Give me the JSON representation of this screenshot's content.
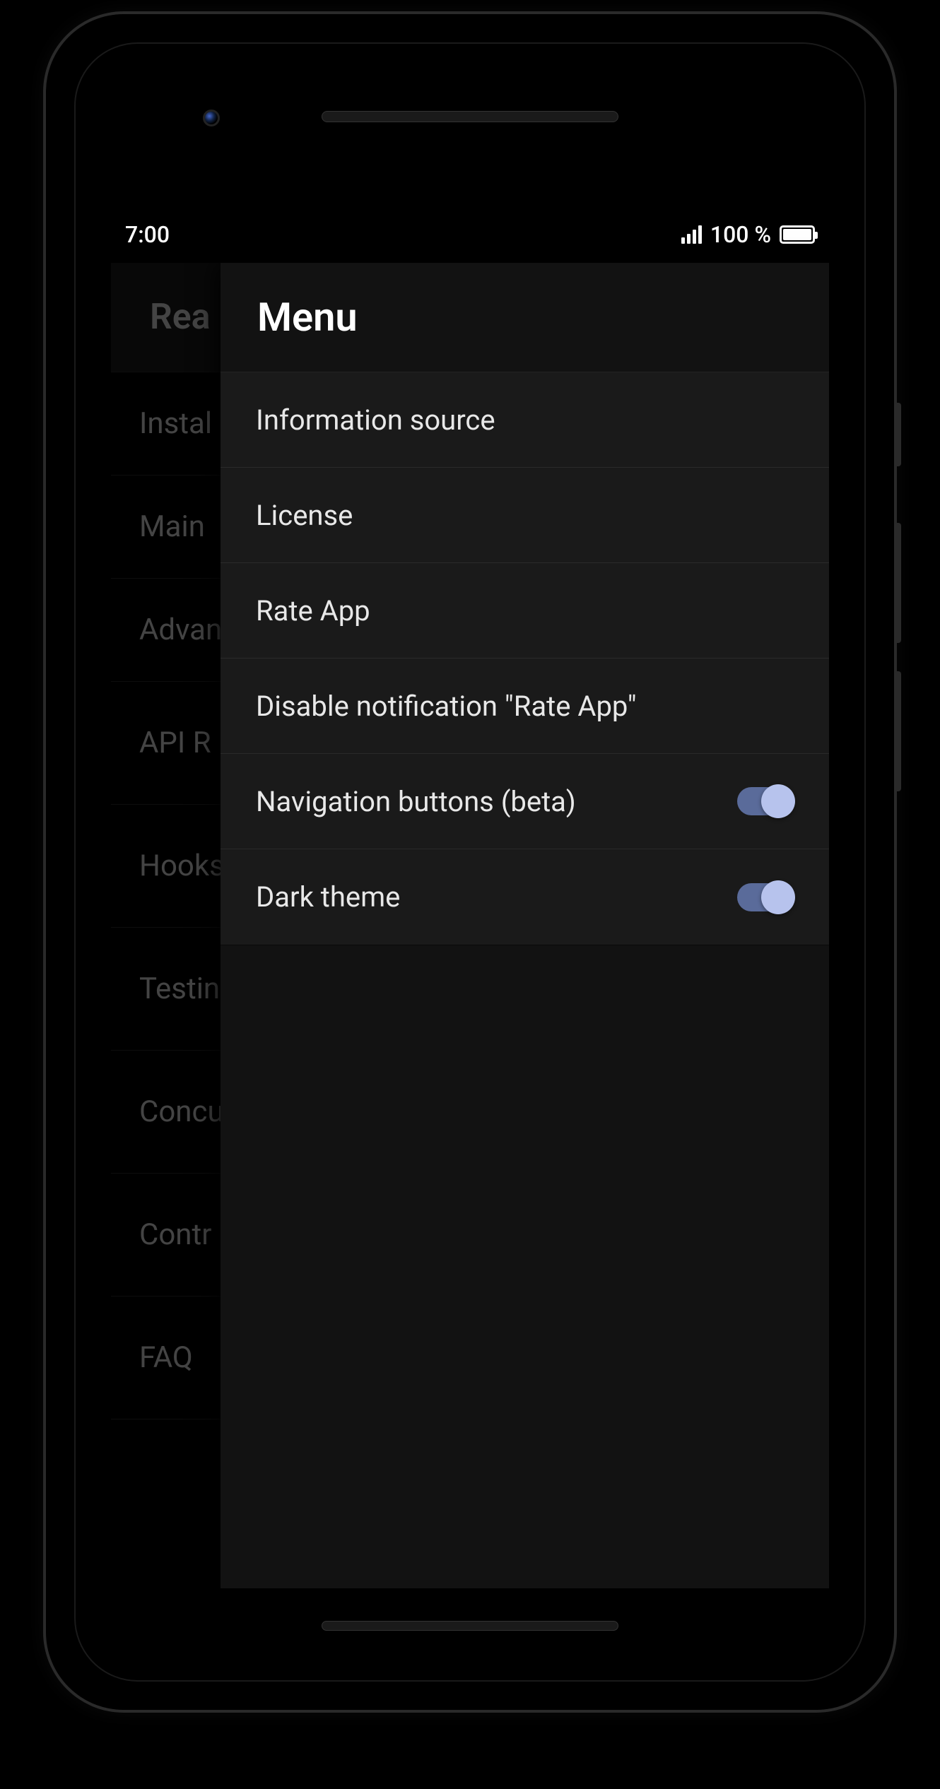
{
  "status": {
    "time": "7:00",
    "battery_text": "100 %"
  },
  "background": {
    "title": "Rea",
    "items": [
      "Instal",
      "Main",
      "Advan",
      "API R",
      "Hooks",
      "Testin",
      "Concu",
      "Contr",
      "FAQ"
    ]
  },
  "drawer": {
    "title": "Menu",
    "items": [
      {
        "label": "Information source",
        "type": "link"
      },
      {
        "label": "License",
        "type": "link"
      },
      {
        "label": "Rate App",
        "type": "link"
      },
      {
        "label": "Disable notification \"Rate App\"",
        "type": "link"
      },
      {
        "label": "Navigation buttons (beta)",
        "type": "toggle",
        "on": true
      },
      {
        "label": "Dark theme",
        "type": "toggle",
        "on": true
      }
    ]
  }
}
